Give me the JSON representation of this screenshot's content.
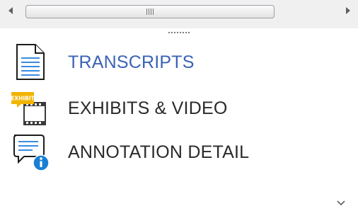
{
  "scrollbar": {
    "left_arrow_icon": "triangle-left",
    "right_arrow_icon": "triangle-right",
    "grip_icon": "vertical-grip-lines"
  },
  "splitter": {
    "icon": "dotted-handle"
  },
  "nav": {
    "items": [
      {
        "label": "TRANSCRIPTS",
        "icon": "document-icon",
        "active": true
      },
      {
        "label": "EXHIBITS & VIDEO",
        "icon": "exhibit-film-icon",
        "badge": "EXHIBIT",
        "active": false
      },
      {
        "label": "ANNOTATION DETAIL",
        "icon": "speech-info-icon",
        "active": false
      }
    ]
  },
  "colors": {
    "active_label": "#3b63b5",
    "label": "#2a2a2a",
    "info_blue": "#1a7fd4",
    "badge_yellow": "#f2b400"
  },
  "footer": {
    "chevron_icon": "chevron-down"
  }
}
